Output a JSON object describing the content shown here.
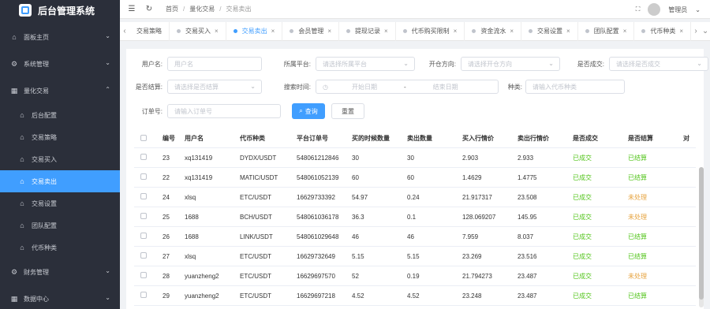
{
  "app": {
    "title": "后台管理系统"
  },
  "sidebar": {
    "items": [
      {
        "label": "面板主页",
        "icon": "home-icon"
      },
      {
        "label": "系统管理",
        "icon": "gear-icon"
      },
      {
        "label": "量化交易",
        "icon": "grid-icon"
      },
      {
        "label": "后台配置",
        "icon": "home-icon"
      },
      {
        "label": "交易策略",
        "icon": "home-icon"
      },
      {
        "label": "交易买入",
        "icon": "home-icon"
      },
      {
        "label": "交易卖出",
        "icon": "home-icon"
      },
      {
        "label": "交易设置",
        "icon": "home-icon"
      },
      {
        "label": "团队配置",
        "icon": "home-icon"
      },
      {
        "label": "代币种类",
        "icon": "home-icon"
      },
      {
        "label": "财务管理",
        "icon": "gear-icon"
      },
      {
        "label": "数据中心",
        "icon": "grid-icon"
      }
    ]
  },
  "header": {
    "breadcrumb": [
      "首页",
      "量化交易",
      "交易卖出"
    ],
    "user": "管理员"
  },
  "tabs": [
    "交易策略",
    "交易买入",
    "交易卖出",
    "会员管理",
    "提现记录",
    "代币购买限制",
    "资金流水",
    "交易设置",
    "团队配置",
    "代币种类"
  ],
  "filters": {
    "username_label": "用户名:",
    "username_placeholder": "用户名",
    "platform_label": "所属平台:",
    "platform_placeholder": "请选择所属平台",
    "direction_label": "开仓方向:",
    "direction_placeholder": "请选择开仓方向",
    "deal_label": "是否成交:",
    "deal_placeholder": "请选择是否成交",
    "settle_label": "是否结算:",
    "settle_placeholder": "请选择是否结算",
    "time_label": "搜索时间:",
    "start_placeholder": "开始日期",
    "dash": "-",
    "end_placeholder": "结束日期",
    "coin_label": "种类:",
    "coin_placeholder": "请输入代币种类",
    "order_label": "订单号:",
    "order_placeholder": "请输入订单号",
    "search_label": "查询",
    "reset_label": "重置"
  },
  "table": {
    "columns": [
      "编号",
      "用户名",
      "代币种类",
      "平台订单号",
      "买的时候数量",
      "卖出数量",
      "买入行情价",
      "卖出行情价",
      "是否成交",
      "是否结算",
      "对"
    ],
    "rows": [
      [
        "23",
        "xq131419",
        "DYDX/USDT",
        "548061212846",
        "30",
        "30",
        "2.903",
        "2.933",
        "已成交",
        "已结算"
      ],
      [
        "22",
        "xq131419",
        "MATIC/USDT",
        "548061052139",
        "60",
        "60",
        "1.4629",
        "1.4775",
        "已成交",
        "已结算"
      ],
      [
        "24",
        "xlsq",
        "ETC/USDT",
        "16629733392",
        "54.97",
        "0.24",
        "21.917317",
        "23.508",
        "已成交",
        "未处理"
      ],
      [
        "25",
        "1688",
        "BCH/USDT",
        "548061036178",
        "36.3",
        "0.1",
        "128.069207",
        "145.95",
        "已成交",
        "未处理"
      ],
      [
        "26",
        "1688",
        "LINK/USDT",
        "548061029648",
        "46",
        "46",
        "7.959",
        "8.037",
        "已成交",
        "已结算"
      ],
      [
        "27",
        "xlsq",
        "ETC/USDT",
        "16629732649",
        "5.15",
        "5.15",
        "23.269",
        "23.516",
        "已成交",
        "已结算"
      ],
      [
        "28",
        "yuanzheng2",
        "ETC/USDT",
        "16629697570",
        "52",
        "0.19",
        "21.794273",
        "23.487",
        "已成交",
        "未处理"
      ],
      [
        "29",
        "yuanzheng2",
        "ETC/USDT",
        "16629697218",
        "4.52",
        "4.52",
        "23.248",
        "23.487",
        "已成交",
        "已结算"
      ]
    ]
  },
  "colors": {
    "accent": "#409eff",
    "sidebar_bg": "#2b2f3a",
    "success": "#52c41a",
    "warning": "#e6a23c"
  }
}
